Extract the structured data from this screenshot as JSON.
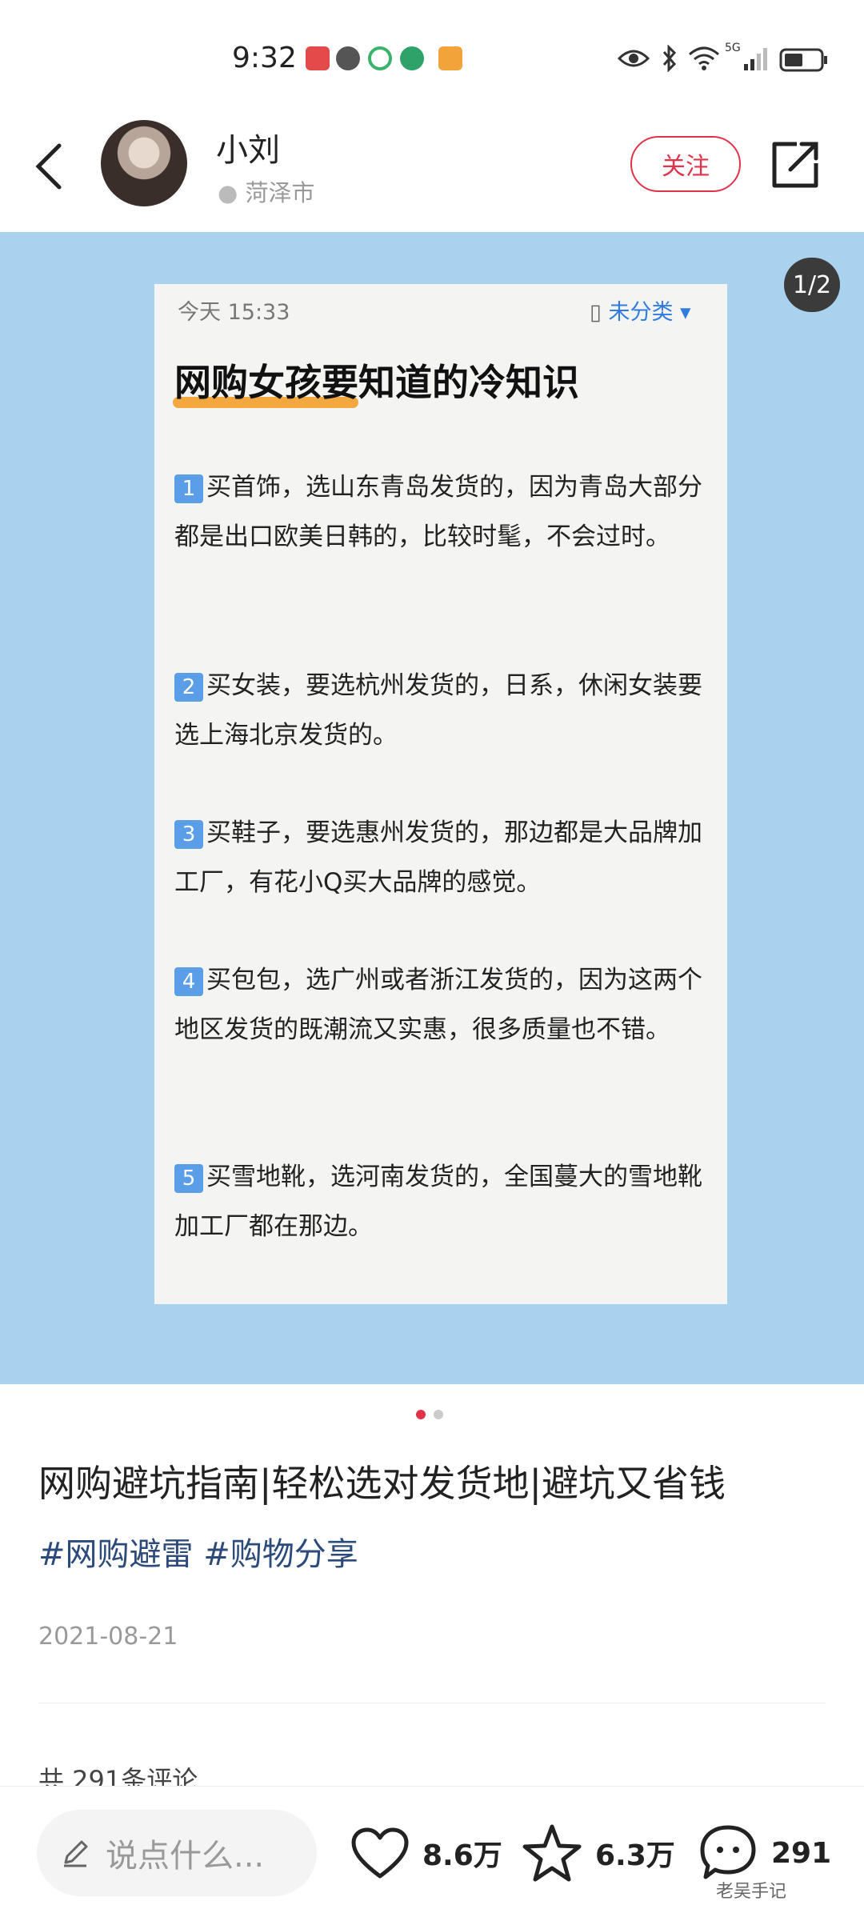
{
  "status_bar": {
    "time": "9:32",
    "network": "5G",
    "left_icons": [
      "book-app-icon",
      "wechat-icon",
      "sync-icon",
      "green-app-icon",
      "jd-app-icon"
    ],
    "right_icons": [
      "eye-icon",
      "bluetooth-icon",
      "wifi-icon",
      "signal-icon",
      "battery-icon"
    ]
  },
  "header": {
    "username": "小刘",
    "location": "菏泽市",
    "follow_label": "关注",
    "back_icon": "back-arrow-icon",
    "share_icon": "share-icon"
  },
  "image": {
    "counter": "1/2",
    "note": {
      "time": "今天 15:33",
      "category": "未分类",
      "title": "网购女孩要知道的冷知识",
      "items": [
        {
          "num": "1",
          "text": "买首饰，选山东青岛发货的，因为青岛大部分都是出口欧美日韩的，比较时髦，不会过时。"
        },
        {
          "num": "2",
          "text": "买女装，要选杭州发货的，日系，休闲女装要选上海北京发货的。"
        },
        {
          "num": "3",
          "text": "买鞋子，要选惠州发货的，那边都是大品牌加工厂，有花小Q买大品牌的感觉。"
        },
        {
          "num": "4",
          "text": "买包包，选广州或者浙江发货的，因为这两个地区发货的既潮流又实惠，很多质量也不错。"
        },
        {
          "num": "5",
          "text": "买雪地靴，选河南发货的，全国蔓大的雪地靴加工厂都在那边。"
        }
      ]
    }
  },
  "post": {
    "title": "网购避坑指南|轻松选对发货地|避坑又省钱",
    "hashtags": "#网购避雷 #购物分享",
    "date": "2021-08-21",
    "comment_count": "共 291条评论"
  },
  "bottom_bar": {
    "input_placeholder": "说点什么...",
    "likes": "8.6万",
    "favorites": "6.3万",
    "comments": "291",
    "watermark": "老吴手记"
  },
  "colors": {
    "accent": "#e0334a",
    "image_bg": "#a9d2ef",
    "hashtag": "#2c4a7a",
    "note_category": "#2f7cde"
  }
}
